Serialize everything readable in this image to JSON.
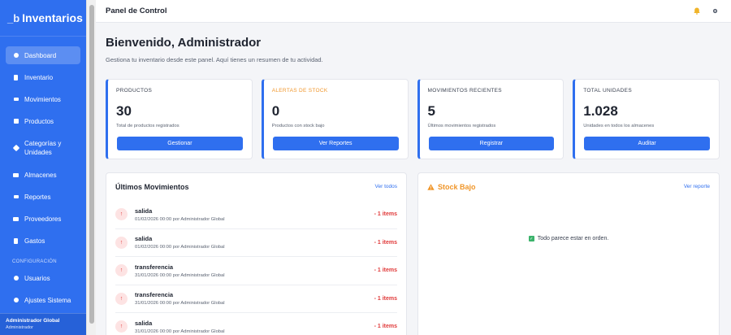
{
  "brand": {
    "logo": "_b",
    "title": "Inventarios"
  },
  "sidebar": {
    "items": [
      {
        "label": "Dashboard",
        "icon": "dashboard-icon"
      },
      {
        "label": "Inventario",
        "icon": "inventory-icon"
      },
      {
        "label": "Movimientos",
        "icon": "transfer-icon"
      },
      {
        "label": "Productos",
        "icon": "products-icon"
      },
      {
        "label": "Categorías y Unidades",
        "icon": "tags-icon"
      },
      {
        "label": "Almacenes",
        "icon": "warehouse-icon"
      },
      {
        "label": "Reportes",
        "icon": "chart-icon"
      },
      {
        "label": "Proveedores",
        "icon": "truck-icon"
      },
      {
        "label": "Gastos",
        "icon": "receipt-icon"
      }
    ],
    "section_label": "CONFIGURACIÓN",
    "config_items": [
      {
        "label": "Usuarios",
        "icon": "users-icon"
      },
      {
        "label": "Ajustes Sistema",
        "icon": "settings-icon"
      }
    ],
    "footer": {
      "name": "Administrador Global",
      "role": "Administrador"
    }
  },
  "topbar": {
    "title": "Panel de Control"
  },
  "header": {
    "title": "Bienvenido, Administrador",
    "subtitle": "Gestiona tu inventario desde este panel. Aquí tienes un resumen de tu actividad."
  },
  "cards": [
    {
      "label": "PRODUCTOS",
      "value": "30",
      "desc": "Total de productos registrados",
      "button": "Gestionar"
    },
    {
      "label": "ALERTAS DE STOCK",
      "value": "0",
      "desc": "Productos con stock bajo",
      "button": "Ver Reportes"
    },
    {
      "label": "MOVIMIENTOS RECIENTES",
      "value": "5",
      "desc": "Últimos movimientos registrados",
      "button": "Registrar"
    },
    {
      "label": "TOTAL UNIDADES",
      "value": "1.028",
      "desc": "Unidades en todos los almacenes",
      "button": "Auditar"
    }
  ],
  "movements": {
    "title": "Últimos Movimientos",
    "link": "Ver todos",
    "rows": [
      {
        "type": "salida",
        "meta": "01/02/2026 00:00 por Administrador Global",
        "qty": "- 1 items"
      },
      {
        "type": "salida",
        "meta": "01/02/2026 00:00 por Administrador Global",
        "qty": "- 1 items"
      },
      {
        "type": "transferencia",
        "meta": "31/01/2026 00:00 por Administrador Global",
        "qty": "- 1 items"
      },
      {
        "type": "transferencia",
        "meta": "31/01/2026 00:00 por Administrador Global",
        "qty": "- 1 items"
      },
      {
        "type": "salida",
        "meta": "31/01/2026 00:00 por Administrador Global",
        "qty": "- 1 items"
      }
    ]
  },
  "stock": {
    "title": "Stock Bajo",
    "link": "Ver reporte",
    "message": "Todo parece estar en orden."
  },
  "colors": {
    "primary": "#2f6fef",
    "warning": "#f0962a",
    "danger": "#e03a3a",
    "success": "#3bb36b"
  }
}
